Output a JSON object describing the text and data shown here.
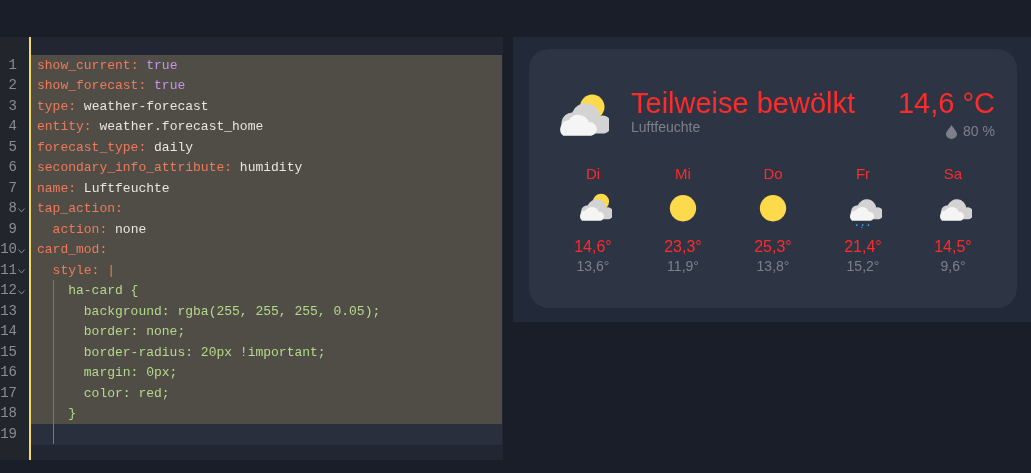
{
  "editor": {
    "lines": [
      {
        "number": "1",
        "foldable": false,
        "selected": true,
        "segments": [
          {
            "kind": "key",
            "text": "show_current"
          },
          {
            "kind": "punct",
            "text": ": "
          },
          {
            "kind": "bool",
            "text": "true"
          }
        ]
      },
      {
        "number": "2",
        "foldable": false,
        "selected": true,
        "segments": [
          {
            "kind": "key",
            "text": "show_forecast"
          },
          {
            "kind": "punct",
            "text": ": "
          },
          {
            "kind": "bool",
            "text": "true"
          }
        ]
      },
      {
        "number": "3",
        "foldable": false,
        "selected": true,
        "segments": [
          {
            "kind": "key",
            "text": "type"
          },
          {
            "kind": "punct",
            "text": ": "
          },
          {
            "kind": "text",
            "text": "weather-forecast"
          }
        ]
      },
      {
        "number": "4",
        "foldable": false,
        "selected": true,
        "segments": [
          {
            "kind": "key",
            "text": "entity"
          },
          {
            "kind": "punct",
            "text": ": "
          },
          {
            "kind": "text",
            "text": "weather.forecast_home"
          }
        ]
      },
      {
        "number": "5",
        "foldable": false,
        "selected": true,
        "segments": [
          {
            "kind": "key",
            "text": "forecast_type"
          },
          {
            "kind": "punct",
            "text": ": "
          },
          {
            "kind": "text",
            "text": "daily"
          }
        ]
      },
      {
        "number": "6",
        "foldable": false,
        "selected": true,
        "segments": [
          {
            "kind": "key",
            "text": "secondary_info_attribute"
          },
          {
            "kind": "punct",
            "text": ": "
          },
          {
            "kind": "text",
            "text": "humidity"
          }
        ]
      },
      {
        "number": "7",
        "foldable": false,
        "selected": true,
        "segments": [
          {
            "kind": "key",
            "text": "name"
          },
          {
            "kind": "punct",
            "text": ": "
          },
          {
            "kind": "text",
            "text": "Luftfeuchte"
          }
        ]
      },
      {
        "number": "8",
        "foldable": true,
        "selected": true,
        "segments": [
          {
            "kind": "key",
            "text": "tap_action"
          },
          {
            "kind": "punct",
            "text": ":"
          }
        ]
      },
      {
        "number": "9",
        "foldable": false,
        "selected": true,
        "segments": [
          {
            "kind": "key",
            "text": "  action"
          },
          {
            "kind": "punct",
            "text": ": "
          },
          {
            "kind": "text",
            "text": "none"
          }
        ]
      },
      {
        "number": "10",
        "foldable": true,
        "selected": true,
        "segments": [
          {
            "kind": "key",
            "text": "card_mod"
          },
          {
            "kind": "punct",
            "text": ":"
          }
        ]
      },
      {
        "number": "11",
        "foldable": true,
        "selected": true,
        "segments": [
          {
            "kind": "key",
            "text": "  style"
          },
          {
            "kind": "punct",
            "text": ": "
          },
          {
            "kind": "key",
            "text": "|"
          }
        ]
      },
      {
        "number": "12",
        "foldable": true,
        "selected": true,
        "segments": [
          {
            "kind": "css",
            "text": "    ha-card {"
          }
        ]
      },
      {
        "number": "13",
        "foldable": false,
        "selected": true,
        "segments": [
          {
            "kind": "css",
            "text": "      background: rgba(255, 255, 255, 0.05);"
          }
        ]
      },
      {
        "number": "14",
        "foldable": false,
        "selected": true,
        "segments": [
          {
            "kind": "css",
            "text": "      border: none;"
          }
        ]
      },
      {
        "number": "15",
        "foldable": false,
        "selected": true,
        "segments": [
          {
            "kind": "css",
            "text": "      border-radius: 20px !important;"
          }
        ]
      },
      {
        "number": "16",
        "foldable": false,
        "selected": true,
        "segments": [
          {
            "kind": "css",
            "text": "      margin: 0px;"
          }
        ]
      },
      {
        "number": "17",
        "foldable": false,
        "selected": true,
        "segments": [
          {
            "kind": "css",
            "text": "      color: red;"
          }
        ]
      },
      {
        "number": "18",
        "foldable": false,
        "selected": true,
        "segments": [
          {
            "kind": "css",
            "text": "    }"
          }
        ]
      },
      {
        "number": "19",
        "foldable": false,
        "selected": false
      }
    ]
  },
  "weather_card": {
    "condition": "Teilweise bewölkt",
    "kind": "partly-cloudy",
    "name": "Luftfeuchte",
    "temperature": "14,6 °C",
    "humidity": "80 %",
    "forecast": [
      {
        "day": "Di",
        "kind": "partly-cloudy",
        "high": "14,6°",
        "low": "13,6°"
      },
      {
        "day": "Mi",
        "kind": "sunny",
        "high": "23,3°",
        "low": "11,9°"
      },
      {
        "day": "Do",
        "kind": "sunny",
        "high": "25,3°",
        "low": "13,8°"
      },
      {
        "day": "Fr",
        "kind": "rainy",
        "high": "21,4°",
        "low": "15,2°"
      },
      {
        "day": "Sa",
        "kind": "cloudy",
        "high": "14,5°",
        "low": "9,6°"
      }
    ]
  }
}
